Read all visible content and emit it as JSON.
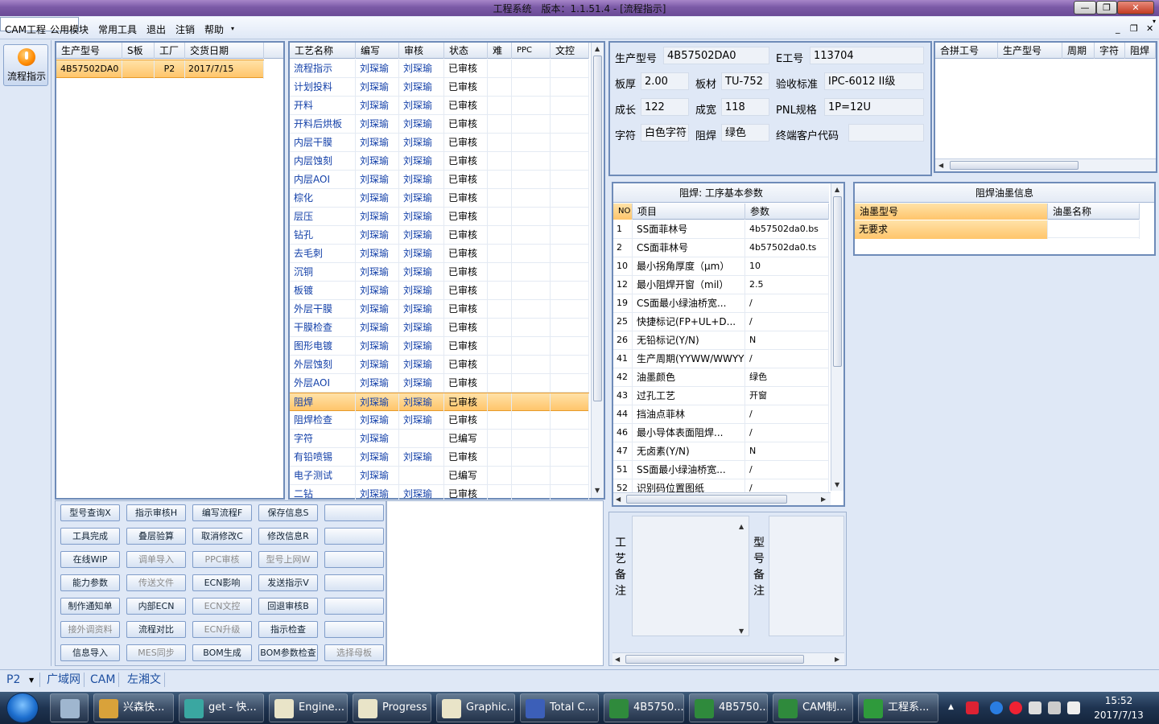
{
  "window": {
    "title": "工程系统　版本：1.1.51.4 - [流程指示]",
    "minimize_label": "—",
    "restore_label": "❐",
    "close_label": "✕",
    "mdi_min": "_",
    "mdi_restore": "❐",
    "mdi_close": "✕"
  },
  "menu": {
    "items": [
      "CAM工程",
      "公用模块",
      "常用工具",
      "退出",
      "注销",
      "帮助"
    ],
    "help_arrow": "▾",
    "combo_arrow": "▾"
  },
  "leftnav": {
    "button_label": "流程指示"
  },
  "job_grid": {
    "headers": [
      "生产型号",
      "S板",
      "工厂",
      "交货日期"
    ],
    "rows": [
      [
        "4B57502DA0",
        "",
        "P2",
        "2017/7/15"
      ]
    ]
  },
  "process_grid": {
    "headers": [
      "工艺名称",
      "编写",
      "审核",
      "状态",
      "难",
      "PPC",
      "文控"
    ],
    "rows": [
      [
        "流程指示",
        "刘琛瑜",
        "刘琛瑜",
        "已审核"
      ],
      [
        "计划投料",
        "刘琛瑜",
        "刘琛瑜",
        "已审核"
      ],
      [
        "开料",
        "刘琛瑜",
        "刘琛瑜",
        "已审核"
      ],
      [
        "开料后烘板",
        "刘琛瑜",
        "刘琛瑜",
        "已审核"
      ],
      [
        "内层干膜",
        "刘琛瑜",
        "刘琛瑜",
        "已审核"
      ],
      [
        "内层蚀刻",
        "刘琛瑜",
        "刘琛瑜",
        "已审核"
      ],
      [
        "内层AOI",
        "刘琛瑜",
        "刘琛瑜",
        "已审核"
      ],
      [
        "棕化",
        "刘琛瑜",
        "刘琛瑜",
        "已审核"
      ],
      [
        "层压",
        "刘琛瑜",
        "刘琛瑜",
        "已审核"
      ],
      [
        "钻孔",
        "刘琛瑜",
        "刘琛瑜",
        "已审核"
      ],
      [
        "去毛刺",
        "刘琛瑜",
        "刘琛瑜",
        "已审核"
      ],
      [
        "沉铜",
        "刘琛瑜",
        "刘琛瑜",
        "已审核"
      ],
      [
        "板镀",
        "刘琛瑜",
        "刘琛瑜",
        "已审核"
      ],
      [
        "外层干膜",
        "刘琛瑜",
        "刘琛瑜",
        "已审核"
      ],
      [
        "干膜检查",
        "刘琛瑜",
        "刘琛瑜",
        "已审核"
      ],
      [
        "图形电镀",
        "刘琛瑜",
        "刘琛瑜",
        "已审核"
      ],
      [
        "外层蚀刻",
        "刘琛瑜",
        "刘琛瑜",
        "已审核"
      ],
      [
        "外层AOI",
        "刘琛瑜",
        "刘琛瑜",
        "已审核"
      ],
      [
        "阻焊",
        "刘琛瑜",
        "刘琛瑜",
        "已审核"
      ],
      [
        "阻焊检查",
        "刘琛瑜",
        "刘琛瑜",
        "已审核"
      ],
      [
        "字符",
        "刘琛瑜",
        "",
        "已编写"
      ],
      [
        "有铅喷锡",
        "刘琛瑜",
        "刘琛瑜",
        "已审核"
      ],
      [
        "电子测试",
        "刘琛瑜",
        "",
        "已编写"
      ],
      [
        "二钻",
        "刘琛瑜",
        "刘琛瑜",
        "已审核"
      ]
    ],
    "selected_index": 18
  },
  "buttons": [
    [
      "型号查询X",
      "指示审核H",
      "编写流程F",
      "保存信息S",
      ""
    ],
    [
      "工具完成",
      "叠层验算",
      "取消修改C",
      "修改信息R",
      ""
    ],
    [
      "在线WIP",
      "调单导入",
      "PPC审核",
      "型号上网W",
      ""
    ],
    [
      "能力参数",
      "传送文件",
      "ECN影响",
      "发送指示V",
      ""
    ],
    [
      "制作通知单",
      "内部ECN",
      "ECN文控",
      "回退审核B",
      ""
    ],
    [
      "接外调资料",
      "流程对比",
      "ECN升级",
      "指示检查",
      ""
    ],
    [
      "信息导入",
      "MES同步",
      "BOM生成",
      "BOM参数检查",
      "选择母板"
    ]
  ],
  "buttons_disabled": [
    [
      false,
      false,
      false,
      false,
      false
    ],
    [
      false,
      false,
      false,
      false,
      false
    ],
    [
      false,
      true,
      true,
      true,
      false
    ],
    [
      false,
      true,
      false,
      false,
      false
    ],
    [
      false,
      false,
      true,
      false,
      false
    ],
    [
      true,
      false,
      true,
      false,
      false
    ],
    [
      false,
      true,
      false,
      false,
      true
    ]
  ],
  "info": {
    "model_label": "生产型号",
    "model_value": "4B57502DA0",
    "e_label": "E工号",
    "e_value": "113704",
    "thickness_label": "板厚",
    "thickness_value": "2.00",
    "material_label": "板材",
    "material_value": "TU-752",
    "standard_label": "验收标准",
    "standard_value": "IPC-6012 II级",
    "length_label": "成长",
    "length_value": "122",
    "width_label": "成宽",
    "width_value": "118",
    "pnl_label": "PNL规格",
    "pnl_value": "1P=12U",
    "char_label": "字符",
    "char_value": "白色字符",
    "mask_label": "阻焊",
    "mask_value": "绿色",
    "customer_label": "终端客户代码",
    "customer_value": ""
  },
  "merge_grid": {
    "headers": [
      "合拼工号",
      "生产型号",
      "周期",
      "字符",
      "阻焊"
    ]
  },
  "params": {
    "title": "阻焊: 工序基本参数",
    "headers": [
      "NO",
      "项目",
      "参数"
    ],
    "rows": [
      [
        "1",
        "SS面菲林号",
        "4b57502da0.bs"
      ],
      [
        "2",
        "CS面菲林号",
        "4b57502da0.ts"
      ],
      [
        "10",
        "最小拐角厚度（μm）",
        "10"
      ],
      [
        "12",
        "最小阻焊开窗（mil）",
        "2.5"
      ],
      [
        "19",
        "CS面最小绿油桥宽...",
        "/"
      ],
      [
        "25",
        "快捷标记(FP+UL+D...",
        "/"
      ],
      [
        "26",
        "无铅标记(Y/N)",
        "N"
      ],
      [
        "41",
        "生产周期(YYWW/WWYY)",
        "/"
      ],
      [
        "42",
        "油墨颜色",
        "绿色"
      ],
      [
        "43",
        "过孔工艺",
        "开窗"
      ],
      [
        "44",
        "挡油点菲林",
        "/"
      ],
      [
        "46",
        "最小导体表面阻焊...",
        "/"
      ],
      [
        "47",
        "无卤素(Y/N)",
        "N"
      ],
      [
        "51",
        "SS面最小绿油桥宽...",
        "/"
      ],
      [
        "52",
        "识别码位置图纸",
        "/"
      ]
    ]
  },
  "ink": {
    "title": "阻焊油墨信息",
    "headers": [
      "油墨型号",
      "油墨名称"
    ],
    "rows": [
      [
        "无要求",
        ""
      ]
    ]
  },
  "notes": {
    "process_label": "工艺备注",
    "model_label": "型号备注"
  },
  "status": {
    "factory": "P2",
    "net": "广域网",
    "dept": "CAM",
    "user": "左湘文"
  },
  "taskbar": {
    "items": [
      {
        "label": "",
        "color": "#9fb6cf"
      },
      {
        "label": "兴森快...",
        "color": "#d9a23a"
      },
      {
        "label": "get - 快...",
        "color": "#3aa7a1"
      },
      {
        "label": "Engine...",
        "color": "#e9e4c8"
      },
      {
        "label": "Progress",
        "color": "#e9e4c8"
      },
      {
        "label": "Graphic...",
        "color": "#e9e4c8"
      },
      {
        "label": "Total C...",
        "color": "#3c5fb8"
      },
      {
        "label": "4B5750...",
        "color": "#2f8a3c"
      },
      {
        "label": "4B5750...",
        "color": "#2f8a3c"
      },
      {
        "label": "CAM制...",
        "color": "#2f8a3c"
      },
      {
        "label": "工程系...",
        "color": "#2f9a3c"
      }
    ],
    "time": "15:52",
    "date": "2017/7/13"
  }
}
